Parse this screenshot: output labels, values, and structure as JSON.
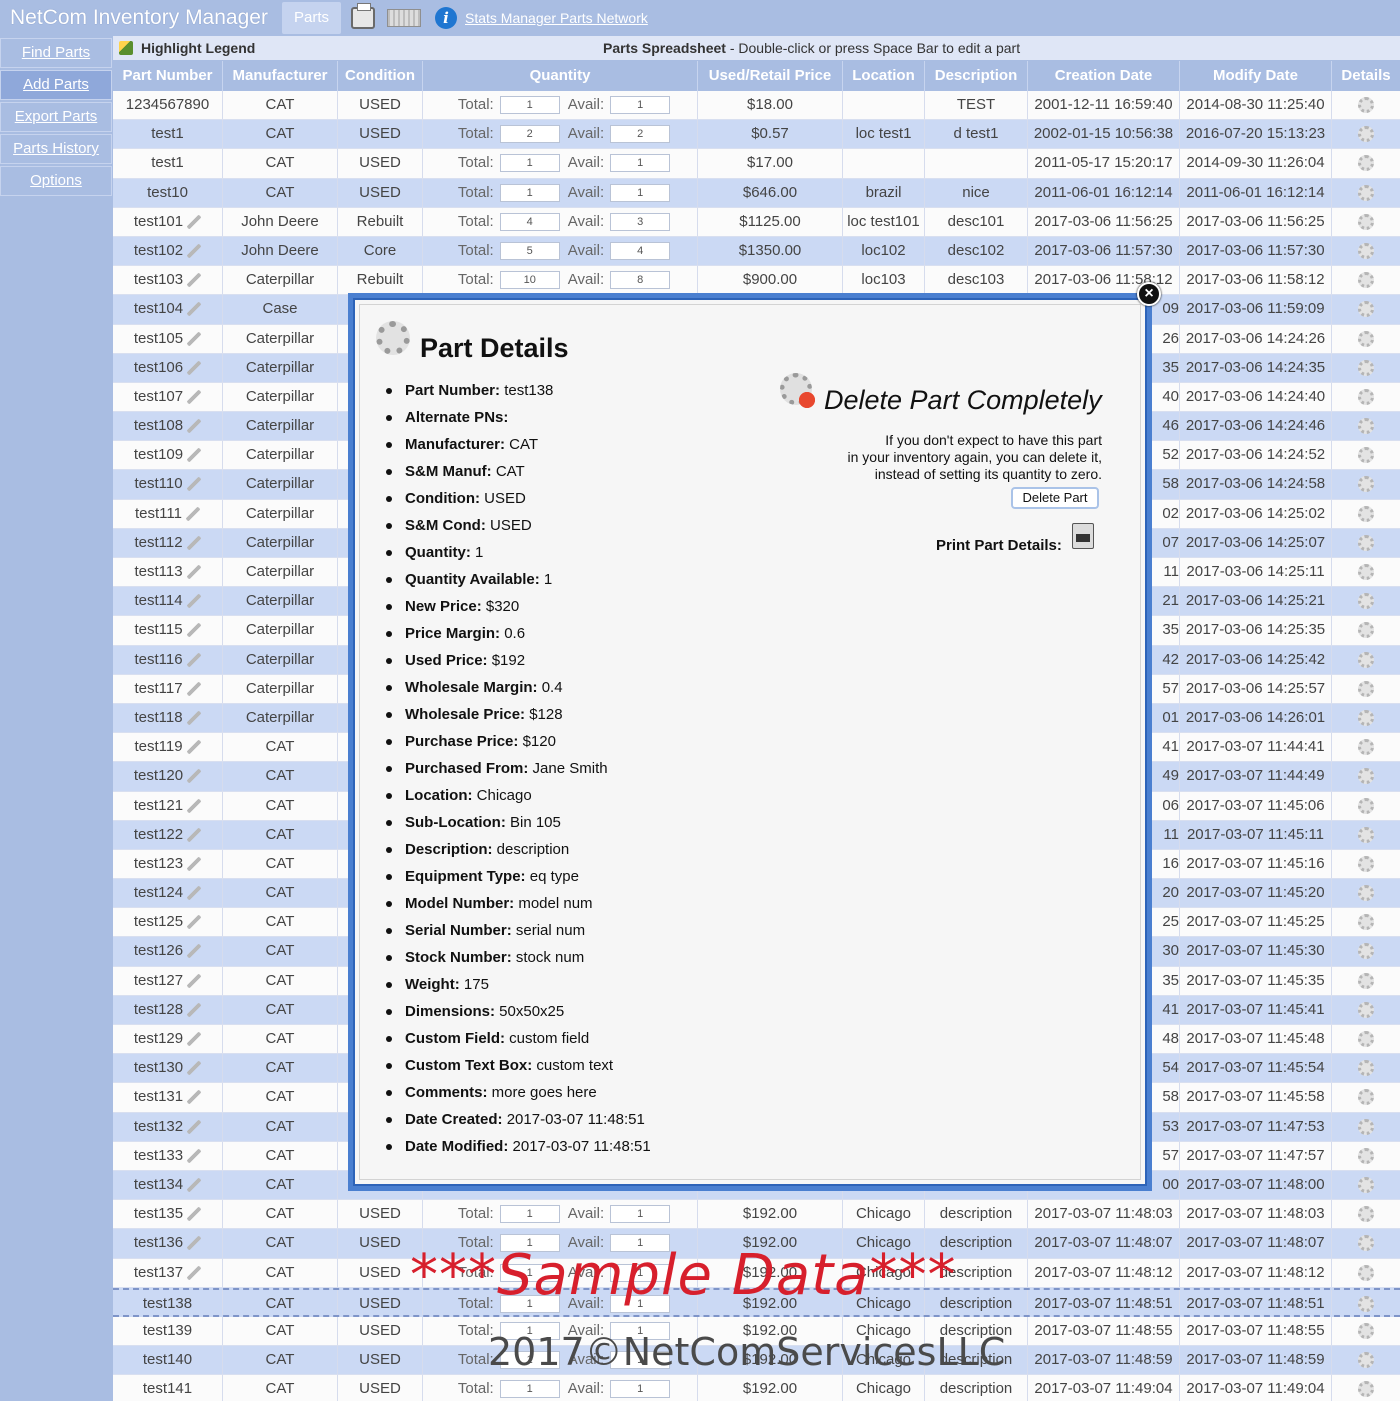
{
  "app": {
    "title": "NetCom Inventory Manager",
    "active_tab": "Parts",
    "links": "Stats Manager Parts Network",
    "icons": [
      "printer-icon",
      "keyboard-icon",
      "info-icon"
    ]
  },
  "sidebar": {
    "items": [
      {
        "label": "Find Parts",
        "active": false
      },
      {
        "label": "Add Parts",
        "active": true
      },
      {
        "label": "Export Parts",
        "active": false
      },
      {
        "label": "Parts History",
        "active": false
      },
      {
        "label": "Options",
        "active": false
      }
    ]
  },
  "legend": {
    "title": "Highlight Legend",
    "sheet_title": "Parts Spreadsheet",
    "sheet_hint": " - Double-click or press Space Bar to edit a part"
  },
  "table": {
    "headers": [
      "Part Number",
      "Manufacturer",
      "Condition",
      "Quantity",
      "Used/Retail Price",
      "Location",
      "Description",
      "Creation Date",
      "Modify Date",
      "Details"
    ],
    "qty_total_label": "Total:",
    "qty_avail_label": "Avail:",
    "rows": [
      {
        "pn": "1234567890",
        "mf": "CAT",
        "cd": "USED",
        "total": "1",
        "avail": "1",
        "price": "$18.00",
        "loc": "",
        "desc": "TEST",
        "created": "2001-12-11 16:59:40",
        "modified": "2014-08-30 11:25:40",
        "link": false
      },
      {
        "pn": "test1",
        "mf": "CAT",
        "cd": "USED",
        "total": "2",
        "avail": "2",
        "price": "$0.57",
        "loc": "loc test1",
        "desc": "d test1",
        "created": "2002-01-15 10:56:38",
        "modified": "2016-07-20 15:13:23",
        "link": false
      },
      {
        "pn": "test1",
        "mf": "CAT",
        "cd": "USED",
        "total": "1",
        "avail": "1",
        "price": "$17.00",
        "loc": "",
        "desc": "",
        "created": "2011-05-17 15:20:17",
        "modified": "2014-09-30 11:26:04",
        "link": false
      },
      {
        "pn": "test10",
        "mf": "CAT",
        "cd": "USED",
        "total": "1",
        "avail": "1",
        "price": "$646.00",
        "loc": "brazil",
        "desc": "nice",
        "created": "2011-06-01 16:12:14",
        "modified": "2011-06-01 16:12:14",
        "link": false
      },
      {
        "pn": "test101",
        "mf": "John Deere",
        "cd": "Rebuilt",
        "total": "4",
        "avail": "3",
        "price": "$1125.00",
        "loc": "loc test101",
        "desc": "desc101",
        "created": "2017-03-06 11:56:25",
        "modified": "2017-03-06 11:56:25",
        "link": true
      },
      {
        "pn": "test102",
        "mf": "John Deere",
        "cd": "Core",
        "total": "5",
        "avail": "4",
        "price": "$1350.00",
        "loc": "loc102",
        "desc": "desc102",
        "created": "2017-03-06 11:57:30",
        "modified": "2017-03-06 11:57:30",
        "link": true
      },
      {
        "pn": "test103",
        "mf": "Caterpillar",
        "cd": "Rebuilt",
        "total": "10",
        "avail": "8",
        "price": "$900.00",
        "loc": "loc103",
        "desc": "desc103",
        "created": "2017-03-06 11:58:12",
        "modified": "2017-03-06 11:58:12",
        "link": true
      },
      {
        "pn": "test104",
        "mf": "Case",
        "cd": "",
        "total": "",
        "avail": "",
        "price": "",
        "loc": "",
        "desc": "",
        "created": "09",
        "modified": "2017-03-06 11:59:09",
        "link": true
      },
      {
        "pn": "test105",
        "mf": "Caterpillar",
        "cd": "",
        "total": "",
        "avail": "",
        "price": "",
        "loc": "",
        "desc": "",
        "created": "26",
        "modified": "2017-03-06 14:24:26",
        "link": true
      },
      {
        "pn": "test106",
        "mf": "Caterpillar",
        "cd": "",
        "total": "",
        "avail": "",
        "price": "",
        "loc": "",
        "desc": "",
        "created": "35",
        "modified": "2017-03-06 14:24:35",
        "link": true
      },
      {
        "pn": "test107",
        "mf": "Caterpillar",
        "cd": "",
        "total": "",
        "avail": "",
        "price": "",
        "loc": "",
        "desc": "",
        "created": "40",
        "modified": "2017-03-06 14:24:40",
        "link": true
      },
      {
        "pn": "test108",
        "mf": "Caterpillar",
        "cd": "",
        "total": "",
        "avail": "",
        "price": "",
        "loc": "",
        "desc": "",
        "created": "46",
        "modified": "2017-03-06 14:24:46",
        "link": true
      },
      {
        "pn": "test109",
        "mf": "Caterpillar",
        "cd": "",
        "total": "",
        "avail": "",
        "price": "",
        "loc": "",
        "desc": "",
        "created": "52",
        "modified": "2017-03-06 14:24:52",
        "link": true
      },
      {
        "pn": "test110",
        "mf": "Caterpillar",
        "cd": "",
        "total": "",
        "avail": "",
        "price": "",
        "loc": "",
        "desc": "",
        "created": "58",
        "modified": "2017-03-06 14:24:58",
        "link": true
      },
      {
        "pn": "test111",
        "mf": "Caterpillar",
        "cd": "",
        "total": "",
        "avail": "",
        "price": "",
        "loc": "",
        "desc": "",
        "created": "02",
        "modified": "2017-03-06 14:25:02",
        "link": true
      },
      {
        "pn": "test112",
        "mf": "Caterpillar",
        "cd": "",
        "total": "",
        "avail": "",
        "price": "",
        "loc": "",
        "desc": "",
        "created": "07",
        "modified": "2017-03-06 14:25:07",
        "link": true
      },
      {
        "pn": "test113",
        "mf": "Caterpillar",
        "cd": "",
        "total": "",
        "avail": "",
        "price": "",
        "loc": "",
        "desc": "",
        "created": "11",
        "modified": "2017-03-06 14:25:11",
        "link": true
      },
      {
        "pn": "test114",
        "mf": "Caterpillar",
        "cd": "",
        "total": "",
        "avail": "",
        "price": "",
        "loc": "",
        "desc": "",
        "created": "21",
        "modified": "2017-03-06 14:25:21",
        "link": true
      },
      {
        "pn": "test115",
        "mf": "Caterpillar",
        "cd": "",
        "total": "",
        "avail": "",
        "price": "",
        "loc": "",
        "desc": "",
        "created": "35",
        "modified": "2017-03-06 14:25:35",
        "link": true
      },
      {
        "pn": "test116",
        "mf": "Caterpillar",
        "cd": "",
        "total": "",
        "avail": "",
        "price": "",
        "loc": "",
        "desc": "",
        "created": "42",
        "modified": "2017-03-06 14:25:42",
        "link": true
      },
      {
        "pn": "test117",
        "mf": "Caterpillar",
        "cd": "",
        "total": "",
        "avail": "",
        "price": "",
        "loc": "",
        "desc": "",
        "created": "57",
        "modified": "2017-03-06 14:25:57",
        "link": true
      },
      {
        "pn": "test118",
        "mf": "Caterpillar",
        "cd": "",
        "total": "",
        "avail": "",
        "price": "",
        "loc": "",
        "desc": "",
        "created": "01",
        "modified": "2017-03-06 14:26:01",
        "link": true
      },
      {
        "pn": "test119",
        "mf": "CAT",
        "cd": "",
        "total": "",
        "avail": "",
        "price": "",
        "loc": "",
        "desc": "",
        "created": "41",
        "modified": "2017-03-07 11:44:41",
        "link": true
      },
      {
        "pn": "test120",
        "mf": "CAT",
        "cd": "",
        "total": "",
        "avail": "",
        "price": "",
        "loc": "",
        "desc": "",
        "created": "49",
        "modified": "2017-03-07 11:44:49",
        "link": true
      },
      {
        "pn": "test121",
        "mf": "CAT",
        "cd": "",
        "total": "",
        "avail": "",
        "price": "",
        "loc": "",
        "desc": "",
        "created": "06",
        "modified": "2017-03-07 11:45:06",
        "link": true
      },
      {
        "pn": "test122",
        "mf": "CAT",
        "cd": "",
        "total": "",
        "avail": "",
        "price": "",
        "loc": "",
        "desc": "",
        "created": "11",
        "modified": "2017-03-07 11:45:11",
        "link": true
      },
      {
        "pn": "test123",
        "mf": "CAT",
        "cd": "",
        "total": "",
        "avail": "",
        "price": "",
        "loc": "",
        "desc": "",
        "created": "16",
        "modified": "2017-03-07 11:45:16",
        "link": true
      },
      {
        "pn": "test124",
        "mf": "CAT",
        "cd": "",
        "total": "",
        "avail": "",
        "price": "",
        "loc": "",
        "desc": "",
        "created": "20",
        "modified": "2017-03-07 11:45:20",
        "link": true
      },
      {
        "pn": "test125",
        "mf": "CAT",
        "cd": "",
        "total": "",
        "avail": "",
        "price": "",
        "loc": "",
        "desc": "",
        "created": "25",
        "modified": "2017-03-07 11:45:25",
        "link": true
      },
      {
        "pn": "test126",
        "mf": "CAT",
        "cd": "",
        "total": "",
        "avail": "",
        "price": "",
        "loc": "",
        "desc": "",
        "created": "30",
        "modified": "2017-03-07 11:45:30",
        "link": true
      },
      {
        "pn": "test127",
        "mf": "CAT",
        "cd": "",
        "total": "",
        "avail": "",
        "price": "",
        "loc": "",
        "desc": "",
        "created": "35",
        "modified": "2017-03-07 11:45:35",
        "link": true
      },
      {
        "pn": "test128",
        "mf": "CAT",
        "cd": "",
        "total": "",
        "avail": "",
        "price": "",
        "loc": "",
        "desc": "",
        "created": "41",
        "modified": "2017-03-07 11:45:41",
        "link": true
      },
      {
        "pn": "test129",
        "mf": "CAT",
        "cd": "",
        "total": "",
        "avail": "",
        "price": "",
        "loc": "",
        "desc": "",
        "created": "48",
        "modified": "2017-03-07 11:45:48",
        "link": true
      },
      {
        "pn": "test130",
        "mf": "CAT",
        "cd": "",
        "total": "",
        "avail": "",
        "price": "",
        "loc": "",
        "desc": "",
        "created": "54",
        "modified": "2017-03-07 11:45:54",
        "link": true
      },
      {
        "pn": "test131",
        "mf": "CAT",
        "cd": "",
        "total": "",
        "avail": "",
        "price": "",
        "loc": "",
        "desc": "",
        "created": "58",
        "modified": "2017-03-07 11:45:58",
        "link": true
      },
      {
        "pn": "test132",
        "mf": "CAT",
        "cd": "",
        "total": "",
        "avail": "",
        "price": "",
        "loc": "",
        "desc": "",
        "created": "53",
        "modified": "2017-03-07 11:47:53",
        "link": true
      },
      {
        "pn": "test133",
        "mf": "CAT",
        "cd": "",
        "total": "",
        "avail": "",
        "price": "",
        "loc": "",
        "desc": "",
        "created": "57",
        "modified": "2017-03-07 11:47:57",
        "link": true
      },
      {
        "pn": "test134",
        "mf": "CAT",
        "cd": "",
        "total": "",
        "avail": "",
        "price": "",
        "loc": "",
        "desc": "",
        "created": "00",
        "modified": "2017-03-07 11:48:00",
        "link": true
      },
      {
        "pn": "test135",
        "mf": "CAT",
        "cd": "USED",
        "total": "1",
        "avail": "1",
        "price": "$192.00",
        "loc": "Chicago",
        "desc": "description",
        "created": "2017-03-07 11:48:03",
        "modified": "2017-03-07 11:48:03",
        "link": true
      },
      {
        "pn": "test136",
        "mf": "CAT",
        "cd": "USED",
        "total": "1",
        "avail": "1",
        "price": "$192.00",
        "loc": "Chicago",
        "desc": "description",
        "created": "2017-03-07 11:48:07",
        "modified": "2017-03-07 11:48:07",
        "link": true
      },
      {
        "pn": "test137",
        "mf": "CAT",
        "cd": "USED",
        "total": "1",
        "avail": "1",
        "price": "$192.00",
        "loc": "Chicago",
        "desc": "description",
        "created": "2017-03-07 11:48:12",
        "modified": "2017-03-07 11:48:12",
        "link": true
      },
      {
        "pn": "test138",
        "mf": "CAT",
        "cd": "USED",
        "total": "1",
        "avail": "1",
        "price": "$192.00",
        "loc": "Chicago",
        "desc": "description",
        "created": "2017-03-07 11:48:51",
        "modified": "2017-03-07 11:48:51",
        "link": false,
        "selected": true
      },
      {
        "pn": "test139",
        "mf": "CAT",
        "cd": "USED",
        "total": "1",
        "avail": "1",
        "price": "$192.00",
        "loc": "Chicago",
        "desc": "description",
        "created": "2017-03-07 11:48:55",
        "modified": "2017-03-07 11:48:55",
        "link": false
      },
      {
        "pn": "test140",
        "mf": "CAT",
        "cd": "USED",
        "total": "1",
        "avail": "1",
        "price": "$192.00",
        "loc": "Chicago",
        "desc": "description",
        "created": "2017-03-07 11:48:59",
        "modified": "2017-03-07 11:48:59",
        "link": false
      },
      {
        "pn": "test141",
        "mf": "CAT",
        "cd": "USED",
        "total": "1",
        "avail": "1",
        "price": "$192.00",
        "loc": "Chicago",
        "desc": "description",
        "created": "2017-03-07 11:49:04",
        "modified": "2017-03-07 11:49:04",
        "link": false
      }
    ]
  },
  "modal": {
    "title": "Part Details",
    "close_glyph": "×",
    "fields": [
      {
        "label": "Part Number:",
        "value": " test138"
      },
      {
        "label": "Alternate PNs:",
        "value": ""
      },
      {
        "label": "Manufacturer:",
        "value": " CAT"
      },
      {
        "label": "S&M Manuf:",
        "value": " CAT"
      },
      {
        "label": "Condition:",
        "value": " USED"
      },
      {
        "label": "S&M Cond:",
        "value": " USED"
      },
      {
        "label": "Quantity:",
        "value": " 1"
      },
      {
        "label": "Quantity Available:",
        "value": " 1"
      },
      {
        "label": "New Price:",
        "value": " $320"
      },
      {
        "label": "Price Margin:",
        "value": " 0.6"
      },
      {
        "label": "Used Price:",
        "value": " $192"
      },
      {
        "label": "Wholesale Margin:",
        "value": " 0.4"
      },
      {
        "label": "Wholesale Price:",
        "value": " $128"
      },
      {
        "label": "Purchase Price:",
        "value": " $120"
      },
      {
        "label": "Purchased From:",
        "value": " Jane Smith"
      },
      {
        "label": "Location:",
        "value": " Chicago"
      },
      {
        "label": "Sub-Location:",
        "value": " Bin 105"
      },
      {
        "label": "Description:",
        "value": " description"
      },
      {
        "label": "Equipment Type:",
        "value": " eq type"
      },
      {
        "label": "Model Number:",
        "value": " model num"
      },
      {
        "label": "Serial Number:",
        "value": " serial num"
      },
      {
        "label": "Stock Number:",
        "value": " stock num"
      },
      {
        "label": "Weight:",
        "value": " 175"
      },
      {
        "label": "Dimensions:",
        "value": " 50x50x25"
      },
      {
        "label": "Custom Field:",
        "value": " custom field"
      },
      {
        "label": "Custom Text Box:",
        "value": " custom text"
      },
      {
        "label": "Comments:",
        "value": " more goes here"
      },
      {
        "label": "Date Created:",
        "value": " 2017-03-07 11:48:51"
      },
      {
        "label": "Date Modified:",
        "value": " 2017-03-07 11:48:51"
      }
    ],
    "delete_title": "Delete Part Completely",
    "delete_text_1": "If you don't expect to have this part",
    "delete_text_2": "in your inventory again, you can delete it,",
    "delete_text_3": "instead of setting its quantity to zero.",
    "delete_button": "Delete Part",
    "print_label": "Print Part Details:"
  },
  "watermark": {
    "sample": "***Sample Data***",
    "copyright": "2017©NetComServicesLLC"
  },
  "colors": {
    "header_bg": "#a9bde2",
    "row_alt": "#cbd9f4",
    "modal_border": "#4a7fd0",
    "watermark_red": "#d71f2c"
  }
}
